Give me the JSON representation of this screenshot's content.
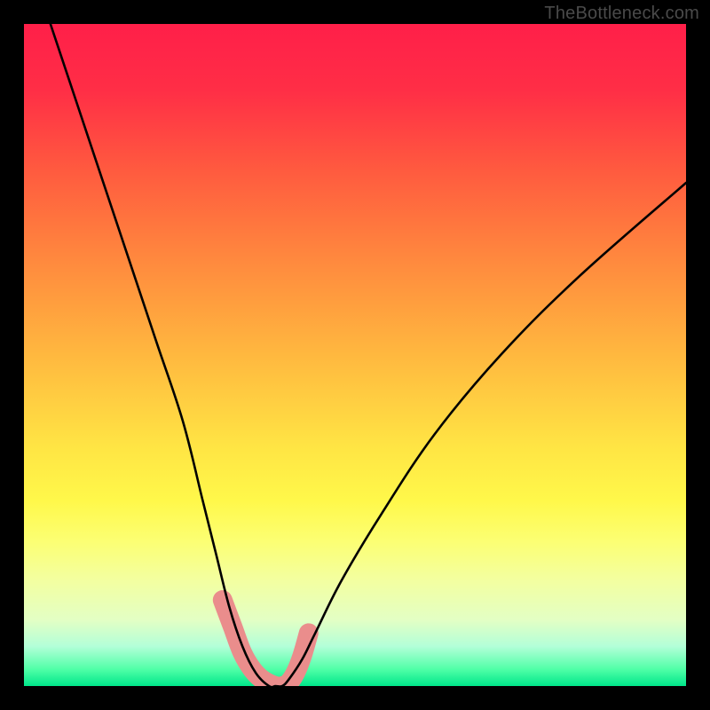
{
  "watermark": "TheBottleneck.com",
  "chart_data": {
    "type": "line",
    "title": "",
    "xlabel": "",
    "ylabel": "",
    "xlim": [
      0,
      100
    ],
    "ylim": [
      0,
      100
    ],
    "series": [
      {
        "name": "bottleneck-curve",
        "x": [
          4,
          8,
          12,
          16,
          20,
          24,
          27,
          29,
          31,
          33,
          35,
          37,
          38,
          39,
          40,
          42,
          44,
          48,
          54,
          62,
          72,
          84,
          100
        ],
        "y": [
          100,
          88,
          76,
          64,
          52,
          40,
          28,
          20,
          12,
          6,
          2,
          0,
          0,
          0,
          1,
          4,
          8,
          16,
          26,
          38,
          50,
          62,
          76
        ]
      }
    ],
    "highlight_region": {
      "name": "salmon-band",
      "color": "#ea8d8c",
      "x": [
        30,
        31.5,
        33,
        34.5,
        36,
        38,
        39,
        40,
        41,
        42,
        43
      ],
      "y": [
        13,
        9,
        5,
        2.5,
        1,
        0,
        0,
        0.5,
        2,
        4.5,
        8
      ]
    },
    "background": {
      "gradient": "red-to-green",
      "top_color": "#ff1f49",
      "bottom_color": "#00e68a"
    }
  }
}
